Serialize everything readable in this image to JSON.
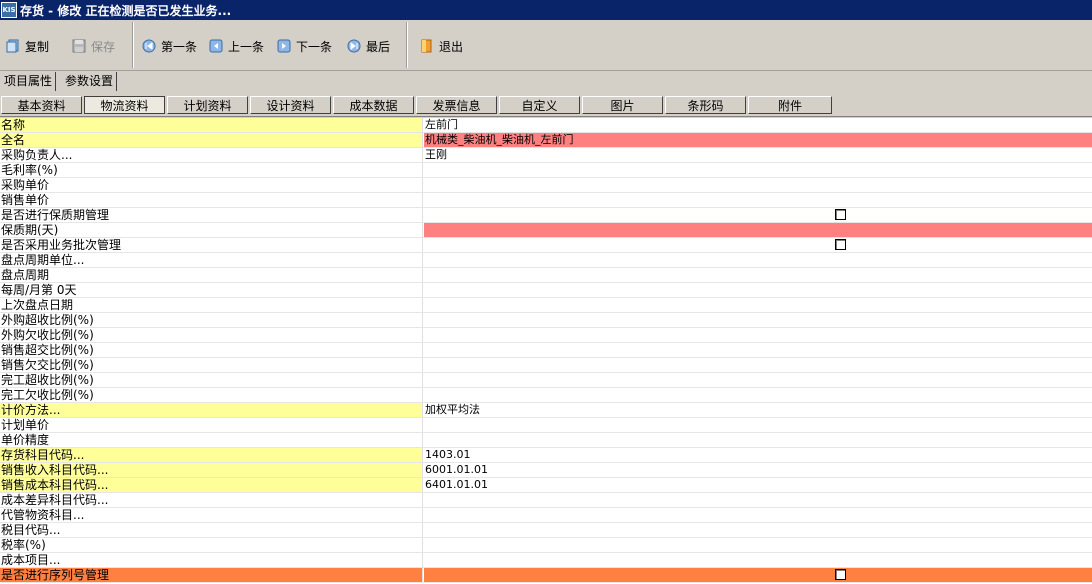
{
  "window": {
    "title": "存货 - 修改 正在检测是否已发生业务...",
    "app_icon": "KIS"
  },
  "toolbar": {
    "copy": "复制",
    "save": "保存",
    "first": "第一条",
    "prev": "上一条",
    "next": "下一条",
    "last": "最后",
    "exit": "退出"
  },
  "outer_tabs": [
    "项目属性",
    "参数设置"
  ],
  "inner_tabs": [
    "基本资料",
    "物流资料",
    "计划资料",
    "设计资料",
    "成本数据",
    "发票信息",
    "自定义",
    "图片",
    "条形码",
    "附件"
  ],
  "active_inner_tab": "物流资料",
  "colors": {
    "required": "#ffff99",
    "error": "#ff8080",
    "selected": "#ff8040"
  },
  "rows": [
    {
      "name": "名称",
      "value": "左前门",
      "nameBg": "#ffff99",
      "valBg": ""
    },
    {
      "name": "全名",
      "value": "机械类_柴油机_柴油机_左前门",
      "nameBg": "#ffff99",
      "valBg": "#ff8080"
    },
    {
      "name": "采购负责人...",
      "value": "王刚",
      "nameBg": "",
      "valBg": ""
    },
    {
      "name": "毛利率(%)",
      "value": "",
      "nameBg": "",
      "valBg": ""
    },
    {
      "name": "采购单价",
      "value": "",
      "nameBg": "",
      "valBg": ""
    },
    {
      "name": "销售单价",
      "value": "",
      "nameBg": "",
      "valBg": ""
    },
    {
      "name": "是否进行保质期管理",
      "value": "",
      "nameBg": "",
      "valBg": "",
      "checkbox": true
    },
    {
      "name": "保质期(天)",
      "value": "",
      "nameBg": "",
      "valBg": "#ff8080"
    },
    {
      "name": "是否采用业务批次管理",
      "value": "",
      "nameBg": "",
      "valBg": "",
      "checkbox": true
    },
    {
      "name": "盘点周期单位...",
      "value": "",
      "nameBg": "",
      "valBg": ""
    },
    {
      "name": "盘点周期",
      "value": "",
      "nameBg": "",
      "valBg": ""
    },
    {
      "name": "每周/月第 0天",
      "value": "",
      "nameBg": "",
      "valBg": ""
    },
    {
      "name": "上次盘点日期",
      "value": "",
      "nameBg": "",
      "valBg": ""
    },
    {
      "name": "外购超收比例(%)",
      "value": "",
      "nameBg": "",
      "valBg": ""
    },
    {
      "name": "外购欠收比例(%)",
      "value": "",
      "nameBg": "",
      "valBg": ""
    },
    {
      "name": "销售超交比例(%)",
      "value": "",
      "nameBg": "",
      "valBg": ""
    },
    {
      "name": "销售欠交比例(%)",
      "value": "",
      "nameBg": "",
      "valBg": ""
    },
    {
      "name": "完工超收比例(%)",
      "value": "",
      "nameBg": "",
      "valBg": ""
    },
    {
      "name": "完工欠收比例(%)",
      "value": "",
      "nameBg": "",
      "valBg": ""
    },
    {
      "name": "计价方法...",
      "value": "加权平均法",
      "nameBg": "#ffff99",
      "valBg": ""
    },
    {
      "name": "计划单价",
      "value": "",
      "nameBg": "",
      "valBg": ""
    },
    {
      "name": "单价精度",
      "value": "",
      "nameBg": "",
      "valBg": ""
    },
    {
      "name": "存货科目代码...",
      "value": "1403.01",
      "nameBg": "#ffff99",
      "valBg": ""
    },
    {
      "name": "销售收入科目代码...",
      "value": "6001.01.01",
      "nameBg": "#ffff99",
      "valBg": ""
    },
    {
      "name": "销售成本科目代码...",
      "value": "6401.01.01",
      "nameBg": "#ffff99",
      "valBg": ""
    },
    {
      "name": "成本差异科目代码...",
      "value": "",
      "nameBg": "",
      "valBg": ""
    },
    {
      "name": "代管物资科目...",
      "value": "",
      "nameBg": "",
      "valBg": ""
    },
    {
      "name": "税目代码...",
      "value": "",
      "nameBg": "",
      "valBg": ""
    },
    {
      "name": "税率(%)",
      "value": "",
      "nameBg": "",
      "valBg": ""
    },
    {
      "name": "成本项目...",
      "value": "",
      "nameBg": "",
      "valBg": ""
    },
    {
      "name": "是否进行序列号管理",
      "value": "",
      "nameBg": "#ff8040",
      "valBg": "#ff8040",
      "checkbox": true
    }
  ]
}
